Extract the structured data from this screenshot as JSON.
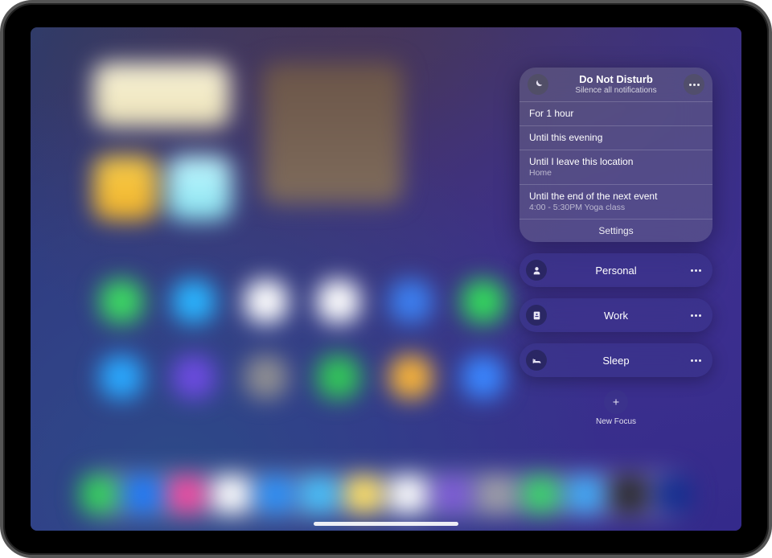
{
  "dnd": {
    "title": "Do Not Disturb",
    "subtitle": "Silence all notifications",
    "options": {
      "for1hour": "For 1 hour",
      "evening": "Until this evening",
      "location_primary": "Until I leave this location",
      "location_secondary": "Home",
      "event_primary": "Until the end of the next event",
      "event_secondary": "4:00 - 5:30PM Yoga class"
    },
    "settings": "Settings"
  },
  "focusModes": {
    "personal": "Personal",
    "work": "Work",
    "sleep": "Sleep"
  },
  "newFocus": "New Focus"
}
